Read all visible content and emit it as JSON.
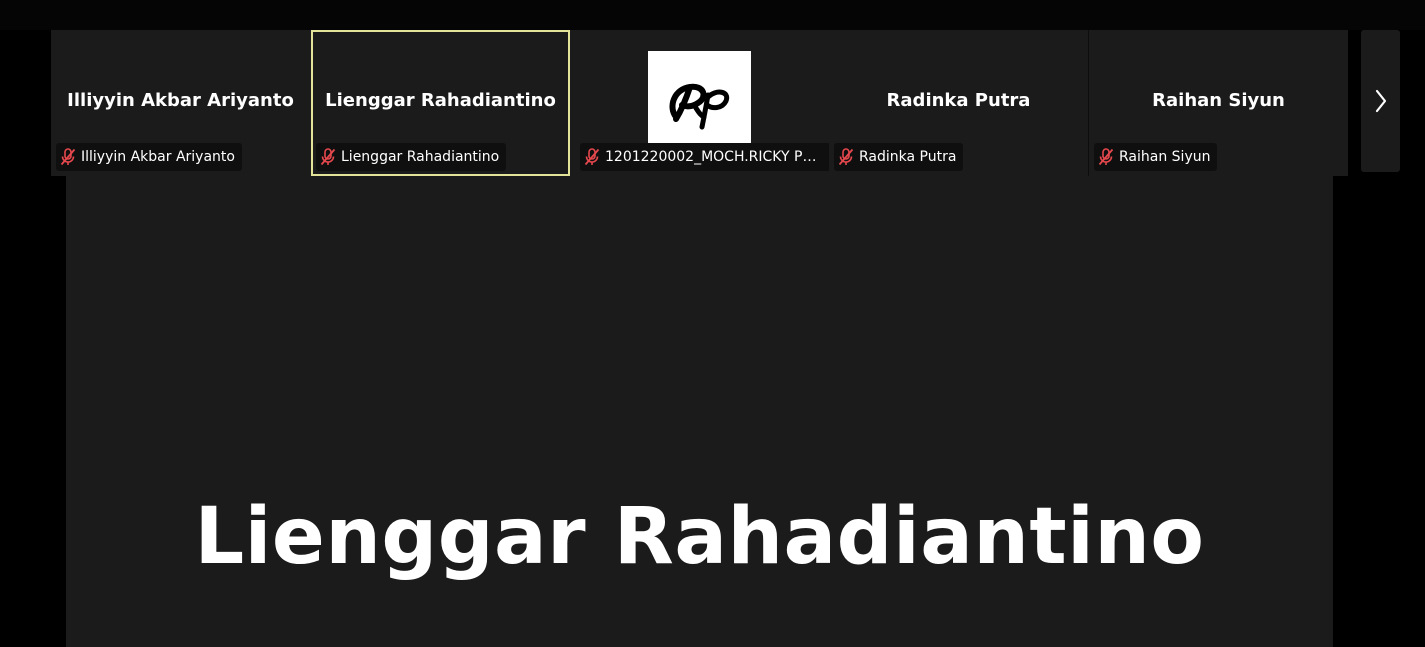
{
  "colors": {
    "background": "#000000",
    "tile_bg": "#1b1b1b",
    "active_border": "#e3e39a",
    "muted_mic": "#e5484d",
    "text": "#ffffff"
  },
  "filmstrip": {
    "tiles": [
      {
        "display_name": "Illiyyin Akbar Ariyanto",
        "tag_label": "Illiyyin Akbar Ariyanto",
        "muted": true,
        "active": false
      },
      {
        "display_name": "Lienggar Rahadiantino",
        "tag_label": "Lienggar Rahadiantino",
        "muted": true,
        "active": true
      },
      {
        "display_name": "",
        "tag_label": "1201220002_MOCH.RICKY PRA...",
        "muted": true,
        "active": false,
        "avatar": "Rp"
      },
      {
        "display_name": "Radinka Putra",
        "tag_label": "Radinka Putra",
        "muted": true,
        "active": false
      },
      {
        "display_name": "Raihan Siyun",
        "tag_label": "Raihan Siyun",
        "muted": true,
        "active": false
      }
    ],
    "next_icon": "chevron-right-icon"
  },
  "main": {
    "speaker_name": "Lienggar Rahadiantino"
  }
}
